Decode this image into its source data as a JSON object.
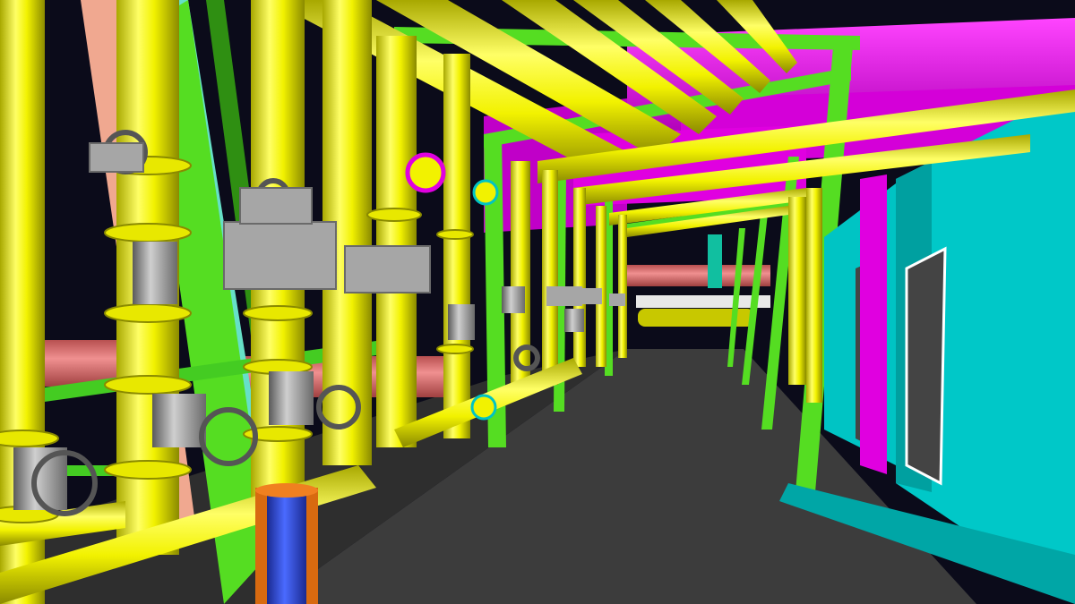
{
  "scene": {
    "colors": {
      "background": "#0b0b1a",
      "floor": "#3c3c3c",
      "process_pipe": "#f2f200",
      "process_pipe_shade": "#a8a800",
      "process_pipe_highlight": "#ffff99",
      "structural_steel": "#55dd22",
      "structural_steel_dark": "#2f8f12",
      "hvac_duct": "#ee00ee",
      "hvac_duct_dark": "#a000a8",
      "equipment_wall": "#00c4c4",
      "equipment_wall_dark": "#008a8a",
      "valve_body": "#9a9a9a",
      "valve_body_dark": "#666666",
      "actuator": "#a6a6a6",
      "salmon_column": "#f0a890",
      "red_pipe": "#e07070",
      "teal_column": "#66e0c8",
      "blue_pipe": "#2a44d8",
      "orange_pipe": "#d86a10",
      "flange_ring": "#ffd44a"
    },
    "elements": [
      "process-pipe",
      "pipe-flange",
      "gate-valve",
      "valve-handwheel",
      "valve-actuator",
      "steel-column",
      "steel-beam",
      "hvac-duct",
      "equipment-wall",
      "floor-walkway",
      "blue-pipe"
    ]
  }
}
